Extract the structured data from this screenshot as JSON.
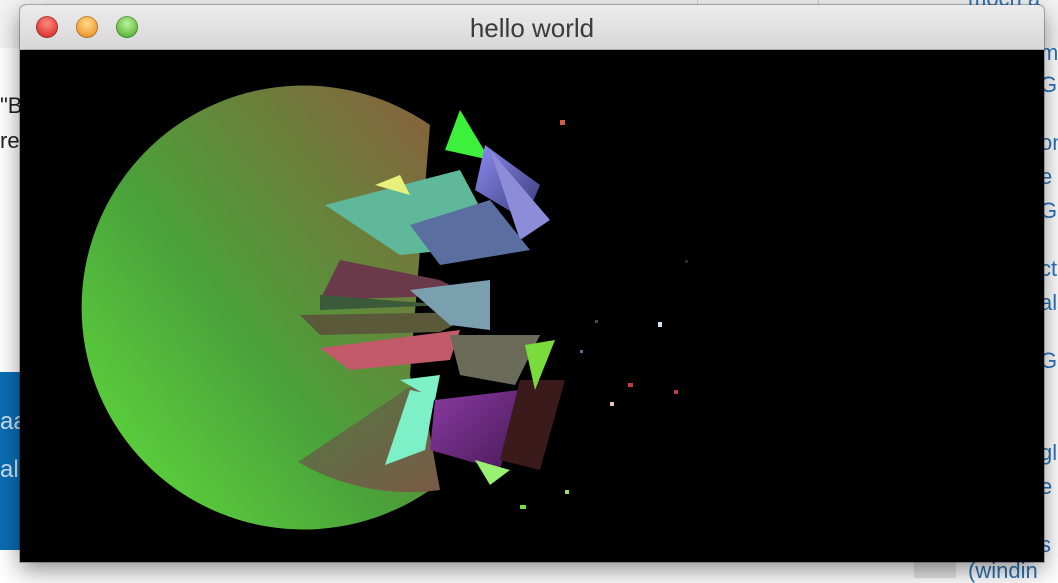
{
  "window": {
    "title": "hello world",
    "buttons": [
      "close",
      "minimize",
      "zoom"
    ]
  },
  "background_page": {
    "top_right_link": "moch a",
    "left_fragments": [
      "\"B",
      "re"
    ],
    "blue_panel_fragments": [
      "aa",
      "al"
    ],
    "right_links": [
      "m",
      "G",
      "on",
      "e",
      "G",
      "ct",
      "als",
      "G",
      "i",
      "gl",
      "e",
      "s"
    ],
    "bottom_right_link": "(windin"
  },
  "canvas": {
    "icon": "rendered-3d-scene",
    "background_color": "#000000"
  }
}
